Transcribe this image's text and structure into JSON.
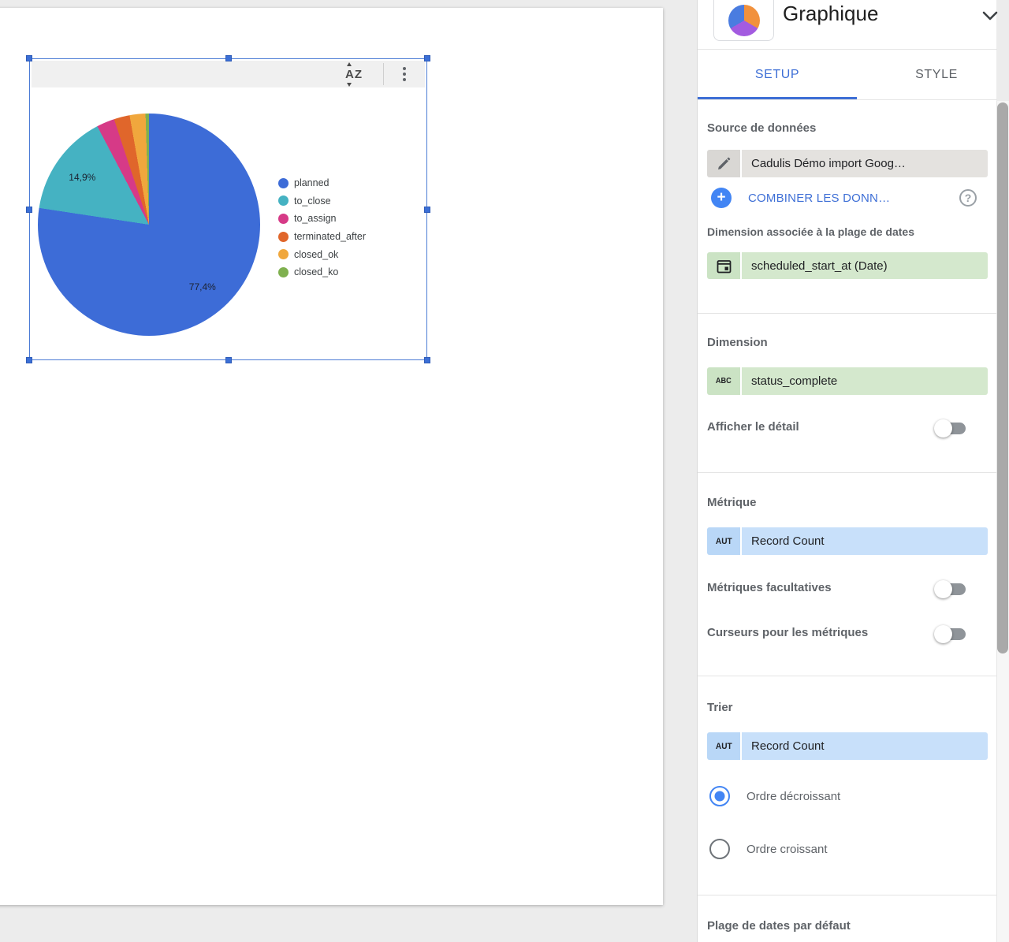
{
  "panel": {
    "title": "Graphique",
    "tabs": {
      "setup": "SETUP",
      "style": "STYLE"
    },
    "source": {
      "heading": "Source de données",
      "value": "Cadulis Démo import Goog…",
      "combine_label": "COMBINER LES DONN…",
      "help_glyph": "?"
    },
    "date_dimension": {
      "heading": "Dimension associée à la plage de dates",
      "value": "scheduled_start_at (Date)"
    },
    "dimension": {
      "heading": "Dimension",
      "type_badge": "ABC",
      "value": "status_complete",
      "drill_label": "Afficher le détail"
    },
    "metric": {
      "heading": "Métrique",
      "type_badge": "AUT",
      "value": "Record Count",
      "optional_label": "Métriques facultatives",
      "sliders_label": "Curseurs pour les métriques"
    },
    "sort": {
      "heading": "Trier",
      "type_badge": "AUT",
      "value": "Record Count",
      "desc_label": "Ordre décroissant",
      "asc_label": "Ordre croissant"
    },
    "date_range": {
      "heading": "Plage de dates par défaut"
    }
  },
  "toolbar": {
    "sort_glyph": "AZ"
  },
  "colors": {
    "accent_blue": "#3E6FD6",
    "selection_blue": "#4b7bd5",
    "field_green": "#d4e8cd",
    "field_blue": "#c8e0fa",
    "field_gray": "#e4e2df"
  },
  "chart_data": {
    "type": "pie",
    "title": "",
    "legend_position": "right",
    "value_format": "percent",
    "slices": [
      {
        "label": "planned",
        "pct": 77.4,
        "pct_label": "77,4%",
        "color": "#3D6CD7"
      },
      {
        "label": "to_close",
        "pct": 14.9,
        "pct_label": "14,9%",
        "color": "#45B2C2"
      },
      {
        "label": "to_assign",
        "pct": 2.6,
        "pct_label": "",
        "color": "#D63A87"
      },
      {
        "label": "terminated_after",
        "pct": 2.3,
        "pct_label": "",
        "color": "#E0662B"
      },
      {
        "label": "closed_ok",
        "pct": 2.3,
        "pct_label": "",
        "color": "#F0A73D"
      },
      {
        "label": "closed_ko",
        "pct": 0.5,
        "pct_label": "",
        "color": "#7FB04F"
      }
    ]
  }
}
